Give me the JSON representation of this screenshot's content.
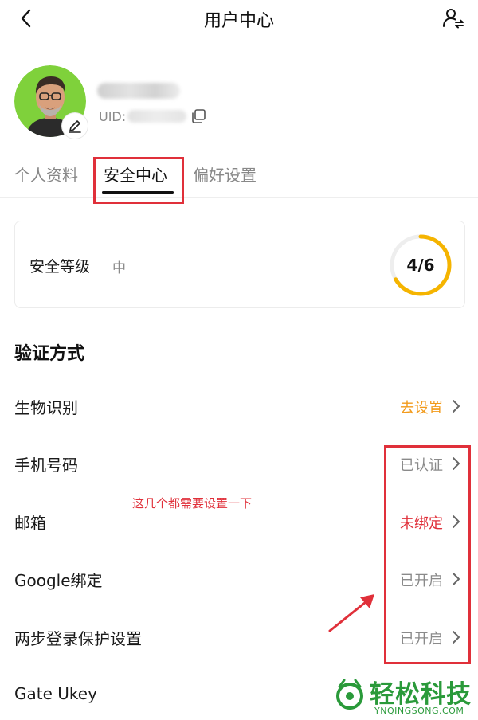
{
  "header": {
    "title": "用户中心",
    "back_icon": "chevron-left-icon",
    "switch_icon": "user-switch-icon"
  },
  "profile": {
    "uid_label": "UID:",
    "edit_icon": "pencil-icon",
    "copy_icon": "copy-icon"
  },
  "tabs": [
    {
      "label": "个人资料",
      "active": false
    },
    {
      "label": "安全中心",
      "active": true
    },
    {
      "label": "偏好设置",
      "active": false
    }
  ],
  "security_level": {
    "label": "安全等级",
    "value": "中",
    "score_text": "4/6",
    "score": 4,
    "max": 6,
    "ring_color": "#f5b400"
  },
  "verification": {
    "title": "验证方式",
    "items": [
      {
        "label": "生物识别",
        "status": "去设置",
        "status_color": "#f29a1a"
      },
      {
        "label": "手机号码",
        "status": "已认证",
        "status_color": "#8a8a8a"
      },
      {
        "label": "邮箱",
        "status": "未绑定",
        "status_color": "#e0303a"
      },
      {
        "label": "Google绑定",
        "status": "已开启",
        "status_color": "#8a8a8a"
      },
      {
        "label": "两步登录保护设置",
        "status": "已开启",
        "status_color": "#8a8a8a"
      },
      {
        "label": "Gate Ukey",
        "status": "",
        "status_color": "#8a8a8a"
      }
    ]
  },
  "annotation": {
    "text": "这几个都需要设置一下",
    "color": "#e0303a"
  },
  "watermark": {
    "brand": "轻松科技",
    "domain": "YNQINGSONG.COM",
    "color": "#2a9a3a"
  }
}
